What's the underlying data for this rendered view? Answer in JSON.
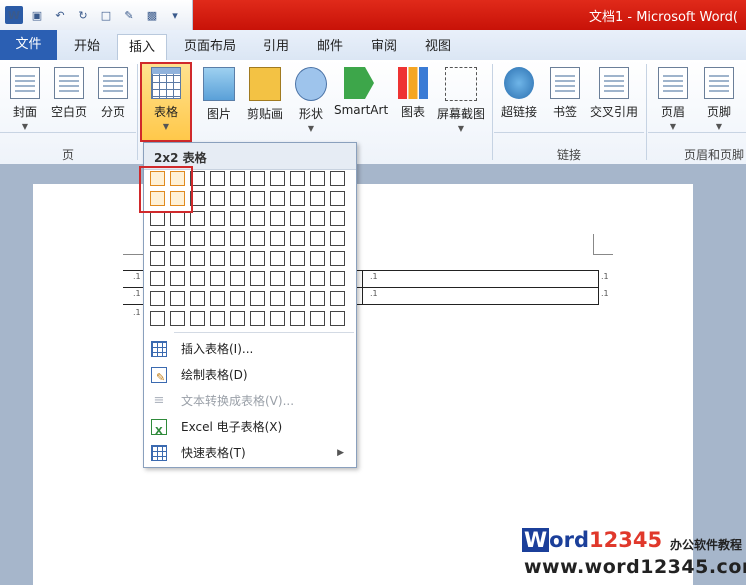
{
  "titlebar": {
    "title": "文档1 - Microsoft Word("
  },
  "qat": {
    "word_logo": "W"
  },
  "tabs": [
    {
      "label": "文件"
    },
    {
      "label": "开始"
    },
    {
      "label": "插入"
    },
    {
      "label": "页面布局"
    },
    {
      "label": "引用"
    },
    {
      "label": "邮件"
    },
    {
      "label": "审阅"
    },
    {
      "label": "视图"
    }
  ],
  "ribbon": {
    "pages_group": {
      "label": "页",
      "cover": "封面",
      "blank": "空白页",
      "break": "分页"
    },
    "table_button": "表格",
    "illus": {
      "picture": "图片",
      "clipart": "剪贴画",
      "shapes": "形状",
      "smartart": "SmartArt",
      "chart": "图表",
      "screenshot": "屏幕截图"
    },
    "links_group": {
      "label": "链接",
      "hyperlink": "超链接",
      "bookmark": "书签",
      "crossref": "交叉引用"
    },
    "header_group": {
      "label": "页眉和页脚",
      "header": "页眉",
      "footer": "页脚"
    }
  },
  "dropdown": {
    "header": "2x2 表格",
    "items": [
      {
        "label": "插入表格(I)..."
      },
      {
        "label": "绘制表格(D)"
      },
      {
        "label": "文本转换成表格(V)..."
      },
      {
        "label": "Excel 电子表格(X)"
      },
      {
        "label": "快速表格(T)"
      }
    ]
  },
  "watermark": {
    "line1_w": "W",
    "line1_rest": "ord",
    "line1_num": "12345",
    "line1_cn": "办公软件教程",
    "line2": "www.word12345.com"
  },
  "colors": {
    "title_red": "#d01e12",
    "file_tab": "#2b5fb3",
    "highlight": "#d0292b"
  }
}
